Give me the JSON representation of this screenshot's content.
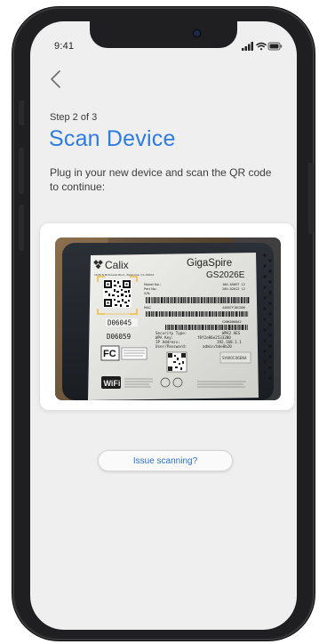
{
  "status_bar": {
    "time": "9:41"
  },
  "header": {
    "step": "Step 2 of 3",
    "title": "Scan Device"
  },
  "instructions": "Plug in your new device and scan the QR code to continue:",
  "device_label": {
    "brand": "Calix",
    "product_line": "GigaSpire",
    "model": "GS2026E",
    "serial_highlight": "D06045",
    "code_secondary": "D06059",
    "address_line": "1035 N McDowell Blvd., Petaluma, CA 94954",
    "field_model_no": "Model No.:",
    "field_part_no": "Part No.:",
    "field_serial_no": "S/N:",
    "value_model_no": "100-05097 12",
    "value_part_no": "200-02012 12",
    "value_serial_no": "CXNK0060A2",
    "mac_label": "MAC",
    "mac_value": "44887F1DCDD6",
    "security_type_label": "Security Type:",
    "security_type_value": "WPA2 AES",
    "wpa_key_label": "WPA Key:",
    "wpa_key_value": "f8f2e86e25332B0",
    "ip_label": "IP Address:",
    "ip_value": "192.168.1.1",
    "user_label": "User/Password:",
    "user_value": "admin/bbe0b20",
    "wifi_badge": "WiFi",
    "fc_badge": "FC",
    "class_badge": "SVW0C06EN4"
  },
  "actions": {
    "issue_label": "Issue scanning?"
  },
  "colors": {
    "accent": "#2d7be3",
    "scan_frame": "#f2b41c",
    "screen_bg": "#efefef"
  },
  "icons": {
    "back": "chevron-left-icon",
    "signal": "cellular-signal-icon",
    "wifi": "wifi-icon",
    "battery": "battery-icon"
  }
}
